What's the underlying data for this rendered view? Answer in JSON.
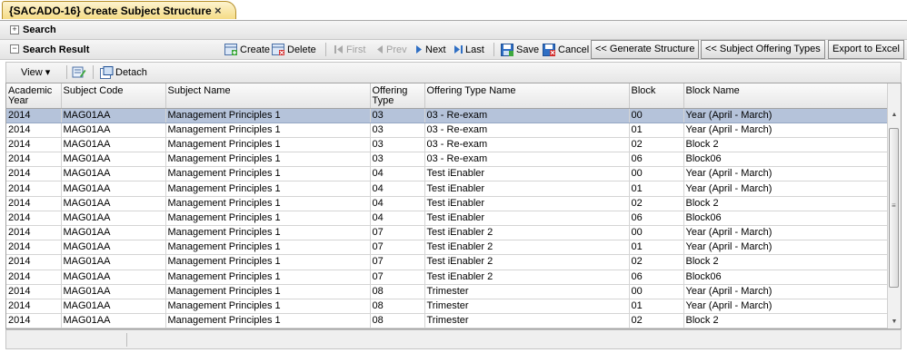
{
  "tab": {
    "title": "{SACADO-16} Create Subject Structure",
    "close": "×"
  },
  "search_section": {
    "title": "Search",
    "expander": "+"
  },
  "result_section": {
    "title": "Search Result",
    "expander": "−"
  },
  "toolbar": {
    "create": "Create",
    "delete": "Delete",
    "first": "First",
    "prev": "Prev",
    "next": "Next",
    "last": "Last",
    "save": "Save",
    "cancel": "Cancel",
    "generate_structure": "<< Generate Structure",
    "subject_offering_types": "<< Subject Offering Types",
    "export_excel": "Export to Excel"
  },
  "grid_toolbar": {
    "view": "View ▾",
    "detach": "Detach"
  },
  "table": {
    "columns": [
      "Academic Year",
      "Subject Code",
      "Subject Name",
      "Offering Type",
      "Offering Type Name",
      "Block",
      "Block Name"
    ],
    "rows": [
      [
        "2014",
        "MAG01AA",
        "Management Principles 1",
        "03",
        "03 - Re-exam",
        "00",
        "Year (April - March)"
      ],
      [
        "2014",
        "MAG01AA",
        "Management Principles 1",
        "03",
        "03 - Re-exam",
        "01",
        "Year (April - March)"
      ],
      [
        "2014",
        "MAG01AA",
        "Management Principles 1",
        "03",
        "03 - Re-exam",
        "02",
        "Block 2"
      ],
      [
        "2014",
        "MAG01AA",
        "Management Principles 1",
        "03",
        "03 - Re-exam",
        "06",
        "Block06"
      ],
      [
        "2014",
        "MAG01AA",
        "Management Principles 1",
        "04",
        "Test iEnabler",
        "00",
        "Year (April - March)"
      ],
      [
        "2014",
        "MAG01AA",
        "Management Principles 1",
        "04",
        "Test iEnabler",
        "01",
        "Year (April - March)"
      ],
      [
        "2014",
        "MAG01AA",
        "Management Principles 1",
        "04",
        "Test iEnabler",
        "02",
        "Block 2"
      ],
      [
        "2014",
        "MAG01AA",
        "Management Principles 1",
        "04",
        "Test iEnabler",
        "06",
        "Block06"
      ],
      [
        "2014",
        "MAG01AA",
        "Management Principles 1",
        "07",
        "Test iEnabler 2",
        "00",
        "Year (April - March)"
      ],
      [
        "2014",
        "MAG01AA",
        "Management Principles 1",
        "07",
        "Test iEnabler 2",
        "01",
        "Year (April - March)"
      ],
      [
        "2014",
        "MAG01AA",
        "Management Principles 1",
        "07",
        "Test iEnabler 2",
        "02",
        "Block 2"
      ],
      [
        "2014",
        "MAG01AA",
        "Management Principles 1",
        "07",
        "Test iEnabler 2",
        "06",
        "Block06"
      ],
      [
        "2014",
        "MAG01AA",
        "Management Principles 1",
        "08",
        "Trimester",
        "00",
        "Year (April - March)"
      ],
      [
        "2014",
        "MAG01AA",
        "Management Principles 1",
        "08",
        "Trimester",
        "01",
        "Year (April - March)"
      ],
      [
        "2014",
        "MAG01AA",
        "Management Principles 1",
        "08",
        "Trimester",
        "02",
        "Block 2"
      ]
    ],
    "selected_row": 0
  },
  "icons": {
    "create": "create-icon",
    "delete": "delete-icon",
    "first": "first-icon",
    "prev": "prev-icon",
    "next": "next-icon",
    "last": "last-icon",
    "save": "save-icon",
    "cancel": "cancel-icon"
  },
  "colors": {
    "tab": "#f5dc86",
    "selected_row": "#b5c3da",
    "nav_arrow": "#2f6fc4"
  }
}
